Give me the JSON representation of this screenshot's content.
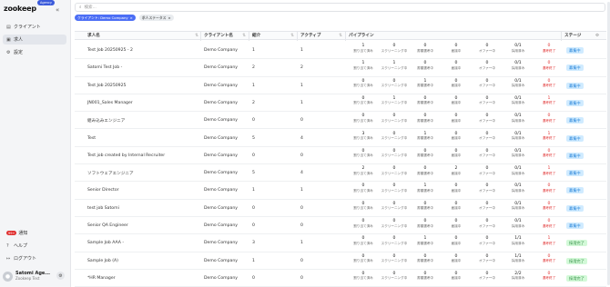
{
  "app": {
    "logo": "zookeep",
    "badge": "Agency"
  },
  "sidebar": {
    "items": [
      {
        "label": "クライアント",
        "icon": "building-icon"
      },
      {
        "label": "求人",
        "icon": "briefcase-icon"
      },
      {
        "label": "設定",
        "icon": "gear-icon"
      }
    ],
    "bottom": [
      {
        "label": "通知",
        "badge": "99+"
      },
      {
        "label": "ヘルプ"
      },
      {
        "label": "ログアウト"
      }
    ],
    "user": {
      "name": "Satomi Age...",
      "org": "Zookeep Test"
    }
  },
  "search": {
    "placeholder": "検索..."
  },
  "filters": [
    {
      "label": "クライアント: Demo Company"
    },
    {
      "label": "求人ステータス"
    }
  ],
  "table": {
    "headers": {
      "title": "求人名",
      "client": "クライアント名",
      "intro": "紹介",
      "active": "アクティブ",
      "pipeline": "パイプライン",
      "stage": "ステージ"
    },
    "pipeline_labels": [
      "割り当て済み",
      "スクリーニング中",
      "書類選考中",
      "面接中",
      "オファー中",
      "採用済み",
      "選考終了"
    ],
    "rows": [
      {
        "title": "Test Job 20250925 - 2",
        "client": "Demo Company",
        "intro": "1",
        "active": "1",
        "p": [
          "1",
          "0",
          "0",
          "0",
          "0",
          "0/1",
          "0"
        ],
        "stage": "募集中",
        "stage_type": "recruiting"
      },
      {
        "title": "Satomi Test Job -",
        "client": "Demo Company",
        "intro": "2",
        "active": "2",
        "p": [
          "1",
          "1",
          "0",
          "0",
          "0",
          "0/1",
          "0"
        ],
        "stage": "募集中",
        "stage_type": "recruiting"
      },
      {
        "title": "Test Job 20250925",
        "client": "Demo Company",
        "intro": "1",
        "active": "1",
        "p": [
          "0",
          "0",
          "1",
          "0",
          "0",
          "0/1",
          "0"
        ],
        "stage": "募集中",
        "stage_type": "recruiting"
      },
      {
        "title": "JN001_Sales Manager",
        "client": "Demo Company",
        "intro": "2",
        "active": "1",
        "p": [
          "0",
          "1",
          "0",
          "0",
          "0",
          "0/1",
          "1"
        ],
        "stage": "募集中",
        "stage_type": "recruiting"
      },
      {
        "title": "組み込みエンジニア",
        "client": "Demo Company",
        "intro": "0",
        "active": "0",
        "p": [
          "0",
          "0",
          "0",
          "0",
          "0",
          "0/1",
          "0"
        ],
        "stage": "募集中",
        "stage_type": "recruiting"
      },
      {
        "title": "Test",
        "client": "Demo Company",
        "intro": "5",
        "active": "4",
        "p": [
          "3",
          "0",
          "1",
          "0",
          "0",
          "0/1",
          "1"
        ],
        "stage": "募集中",
        "stage_type": "recruiting"
      },
      {
        "title": "Test job created by Internal Recruiter",
        "client": "Demo Company",
        "intro": "0",
        "active": "0",
        "p": [
          "0",
          "0",
          "0",
          "0",
          "0",
          "0/1",
          "0"
        ],
        "stage": "募集中",
        "stage_type": "recruiting"
      },
      {
        "title": "ソフトウェアエンジニア",
        "client": "Demo Company",
        "intro": "5",
        "active": "4",
        "p": [
          "2",
          "0",
          "0",
          "2",
          "0",
          "0/1",
          "1"
        ],
        "stage": "募集中",
        "stage_type": "recruiting"
      },
      {
        "title": "Senior Director",
        "client": "Demo Company",
        "intro": "1",
        "active": "1",
        "p": [
          "0",
          "0",
          "1",
          "0",
          "0",
          "0/1",
          "0"
        ],
        "stage": "募集中",
        "stage_type": "recruiting"
      },
      {
        "title": "test job Satomi",
        "client": "Demo Company",
        "intro": "0",
        "active": "0",
        "p": [
          "0",
          "0",
          "0",
          "0",
          "0",
          "0/1",
          "0"
        ],
        "stage": "募集中",
        "stage_type": "recruiting"
      },
      {
        "title": "Senior QA Engineer",
        "client": "Demo Company",
        "intro": "0",
        "active": "0",
        "p": [
          "0",
          "0",
          "0",
          "0",
          "0",
          "0/1",
          "0"
        ],
        "stage": "募集中",
        "stage_type": "recruiting"
      },
      {
        "title": "Sample Job AAA -",
        "client": "Demo Company",
        "intro": "3",
        "active": "1",
        "p": [
          "0",
          "0",
          "1",
          "0",
          "0",
          "1/1",
          "1"
        ],
        "stage": "採用完了",
        "stage_type": "closed"
      },
      {
        "title": "Sample Job (A)",
        "client": "Demo Company",
        "intro": "1",
        "active": "0",
        "p": [
          "0",
          "0",
          "0",
          "0",
          "0",
          "1/1",
          "0"
        ],
        "stage": "採用完了",
        "stage_type": "closed"
      },
      {
        "title": "*HR Manager",
        "client": "Demo Company",
        "intro": "0",
        "active": "0",
        "p": [
          "0",
          "0",
          "0",
          "0",
          "0",
          "2/2",
          "0"
        ],
        "stage": "採用完了",
        "stage_type": "closed"
      }
    ]
  }
}
